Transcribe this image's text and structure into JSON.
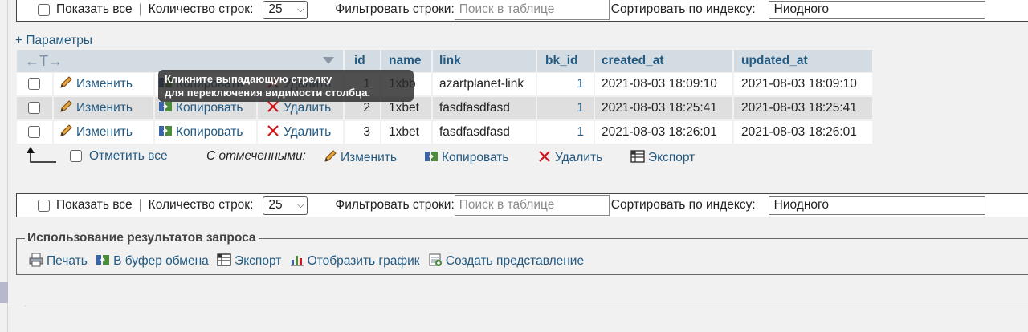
{
  "nav": {
    "show_all": "Показать все",
    "separator": "|",
    "rows_label": "Количество строк:",
    "rows_value": "25",
    "filter_label": "Фильтровать строки:",
    "filter_placeholder": "Поиск в таблице",
    "sort_label": "Сортировать по индексу:",
    "sort_value": "Ниодного"
  },
  "params_link": "+ Параметры",
  "table": {
    "controls_arrows": "←T→",
    "columns": [
      "id",
      "name",
      "link",
      "bk_id",
      "created_at",
      "updated_at"
    ],
    "actions": {
      "edit": "Изменить",
      "copy": "Копировать",
      "delete": "Удалить"
    },
    "rows": [
      {
        "id": "1",
        "name": "1xbb",
        "link": "azartplanet-link",
        "bk_id": "1",
        "created_at": "2021-08-03 18:09:10",
        "updated_at": "2021-08-03 18:09:10"
      },
      {
        "id": "2",
        "name": "1xbet",
        "link": "fasdfasdfasd",
        "bk_id": "1",
        "created_at": "2021-08-03 18:25:41",
        "updated_at": "2021-08-03 18:25:41"
      },
      {
        "id": "3",
        "name": "1xbet",
        "link": "fasdfasdfasd",
        "bk_id": "1",
        "created_at": "2021-08-03 18:26:01",
        "updated_at": "2021-08-03 18:26:01"
      }
    ]
  },
  "tooltip": {
    "line1": "Кликните выпадающую стрелку",
    "line2": "для переключения видимости столбца."
  },
  "bulk": {
    "check_all": "Отметить все",
    "with_selected": "С отмеченными:",
    "edit": "Изменить",
    "copy": "Копировать",
    "delete": "Удалить",
    "export": "Экспорт"
  },
  "query_ops": {
    "legend": "Использование результатов запроса",
    "print": "Печать",
    "clipboard": "В буфер обмена",
    "export": "Экспорт",
    "chart": "Отобразить график",
    "create_view": "Создать представление"
  },
  "colors": {
    "link": "#235a81",
    "header_bg": "#d3dce3",
    "row_even": "#dfdfdf",
    "delete_red": "#d0141a"
  }
}
